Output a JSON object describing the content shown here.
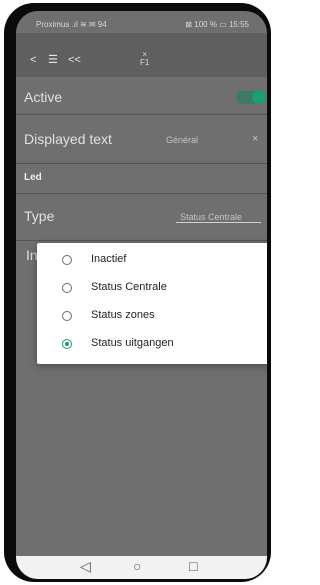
{
  "status_bar": {
    "carrier": "Proximus",
    "left_icons": ".ıl ≋ ✉ 94",
    "right_text": "⊠ 100 % ▭ 15:55"
  },
  "app_bar": {
    "back_icon": "chevron-left-icon",
    "menu_icon": "menu-icon",
    "rewind_icon": "double-chevron-left-icon",
    "center_symbol": "×",
    "center_sub": "F1"
  },
  "settings": {
    "active_label": "Active",
    "active_on": true,
    "displayed_text_label": "Displayed text",
    "displayed_text_value": "Général",
    "section_label": "Led",
    "type_label": "Type",
    "type_value": "Status Centrale",
    "partial_label": "In"
  },
  "dialog": {
    "options": [
      {
        "label": "Inactief",
        "checked": false
      },
      {
        "label": "Status Centrale",
        "checked": false
      },
      {
        "label": "Status zones",
        "checked": false
      },
      {
        "label": "Status uitgangen",
        "checked": true
      }
    ]
  },
  "nav": {
    "back": "◁",
    "home": "○",
    "recents": "□"
  },
  "colors": {
    "accent": "#1a9e6a",
    "screen_dim": "#6f6f6f",
    "app_bar": "#5f5f5f"
  }
}
